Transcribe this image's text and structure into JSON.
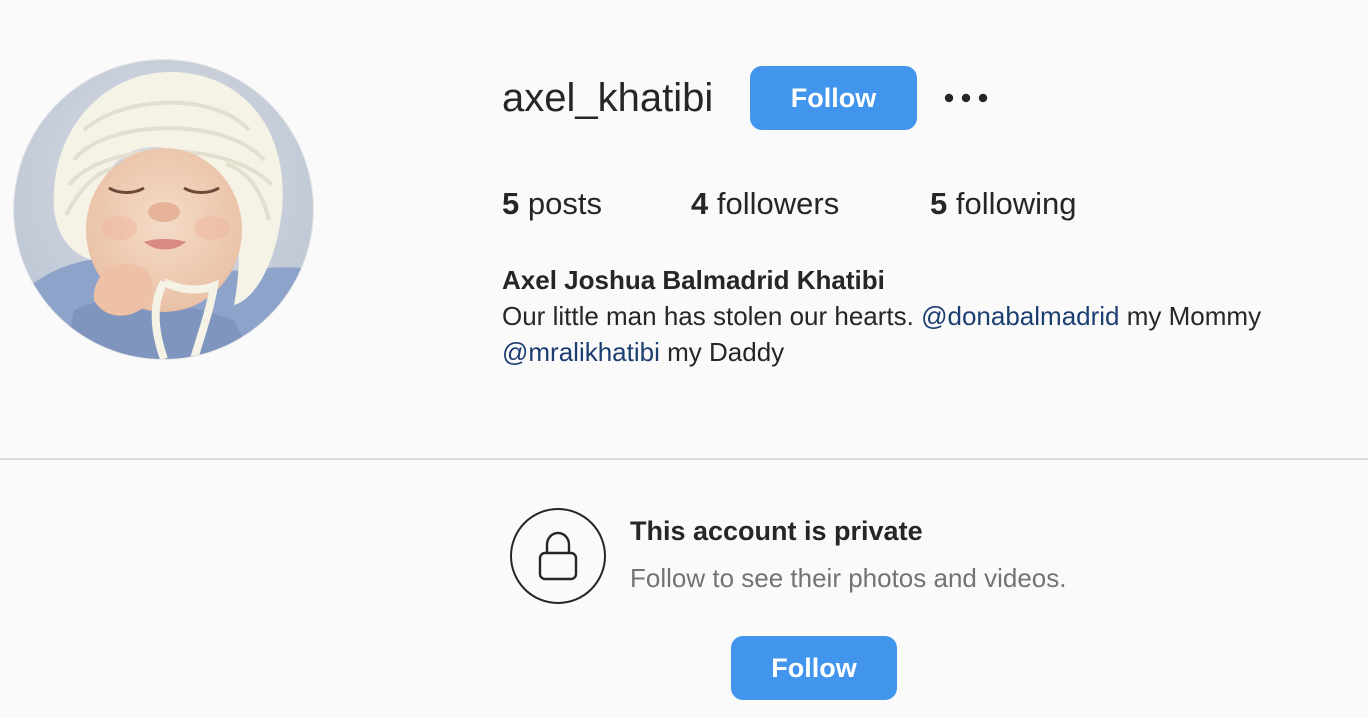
{
  "profile": {
    "username": "axel_khatibi",
    "follow_label": "Follow",
    "more_icon": "more-horizontal-icon",
    "full_name": "Axel Joshua Balmadrid Khatibi",
    "avatar_icon": "profile-photo-baby"
  },
  "stats": {
    "posts": {
      "count": "5",
      "label": "posts"
    },
    "followers": {
      "count": "4",
      "label": "followers"
    },
    "following": {
      "count": "5",
      "label": "following"
    }
  },
  "bio": {
    "line1_text": "Our little man has stolen our hearts.",
    "line1_mention": "@donabalmadrid",
    "line1_suffix": "my Mommy",
    "line2_mention": "@mralikhatibi",
    "line2_suffix": "my Daddy"
  },
  "private": {
    "lock_icon": "lock-icon",
    "title": "This account is private",
    "subtitle": "Follow to see their photos and videos.",
    "follow_label": "Follow"
  },
  "colors": {
    "accent": "#4295ec",
    "mention": "#1c3e71",
    "background": "#fafafa",
    "divider": "#dbdbdb",
    "secondary_text": "#737373"
  }
}
